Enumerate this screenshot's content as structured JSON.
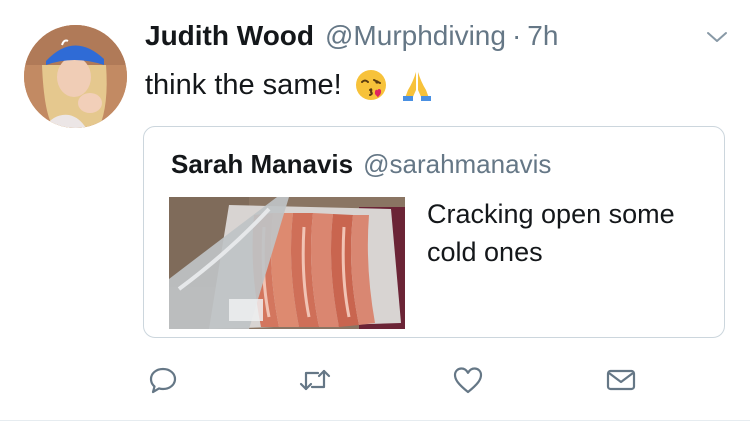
{
  "tweet": {
    "author_name": "Judith Wood",
    "author_handle": "@Murphdiving",
    "separator": "·",
    "time": "7h",
    "text": "think the same!",
    "emojis": [
      "kissing-face-emoji",
      "folded-hands-emoji"
    ],
    "avatar_icon": "user-avatar"
  },
  "quoted_tweet": {
    "author_name": "Sarah Manavis",
    "author_handle": "@sarahmanavis",
    "text": "Cracking open some cold ones",
    "media": "photo-of-packaged-bacon"
  },
  "actions": [
    {
      "name": "reply",
      "icon": "reply-icon"
    },
    {
      "name": "retweet",
      "icon": "retweet-icon"
    },
    {
      "name": "like",
      "icon": "heart-icon"
    },
    {
      "name": "direct-message",
      "icon": "envelope-icon"
    }
  ],
  "colors": {
    "primary_text": "#14171a",
    "secondary_text": "#657786",
    "border": "#ccd6dd",
    "icon": "#657786"
  }
}
